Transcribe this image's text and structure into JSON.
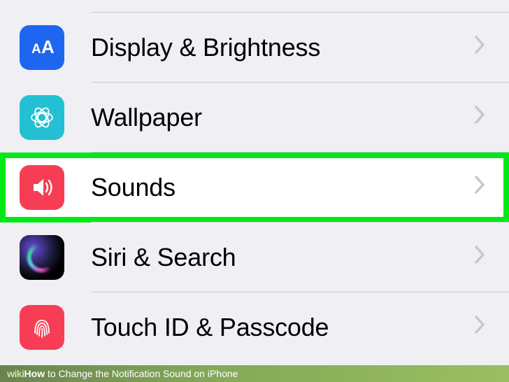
{
  "settings": {
    "items": [
      {
        "label": "Display & Brightness"
      },
      {
        "label": "Wallpaper"
      },
      {
        "label": "Sounds"
      },
      {
        "label": "Siri & Search"
      },
      {
        "label": "Touch ID & Passcode"
      }
    ]
  },
  "footer": {
    "brand": "wiki",
    "how": "How",
    "title": " to Change the Notification Sound on iPhone"
  }
}
